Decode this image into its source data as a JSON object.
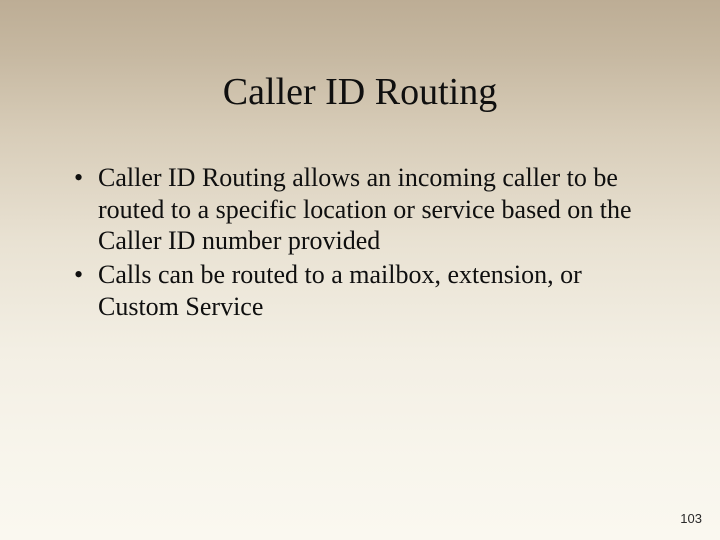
{
  "slide": {
    "title": "Caller ID Routing",
    "bullets": [
      "Caller ID Routing allows an incoming caller to be routed to a specific location or service based on the Caller ID number provided",
      "Calls can be routed to a mailbox, extension, or Custom Service"
    ],
    "page_number": "103",
    "footer_faint": ""
  }
}
